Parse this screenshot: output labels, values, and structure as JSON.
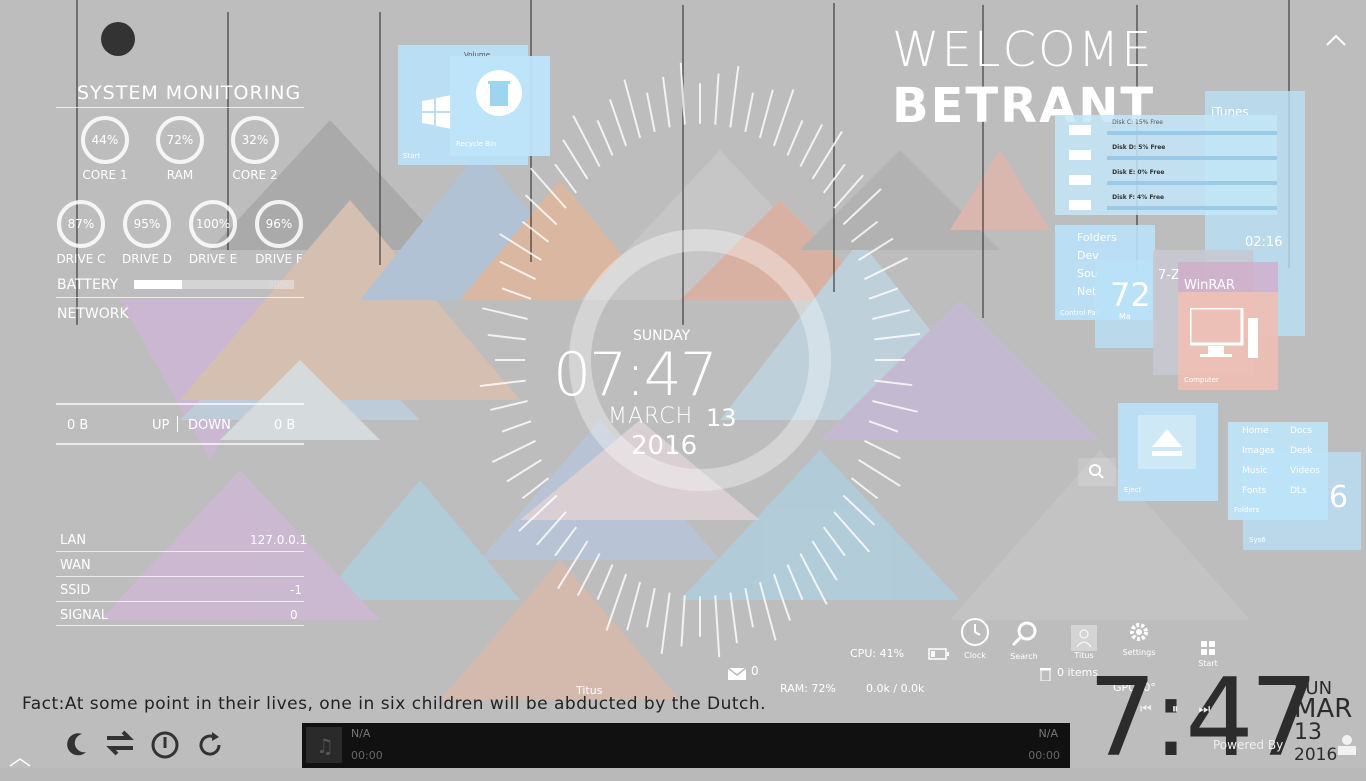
{
  "welcome": {
    "prefix": "WELCOME",
    "name": "BETRANT"
  },
  "monitor": {
    "title": "SYSTEM MONITORING",
    "cpu": [
      {
        "value": "44%",
        "label": "CORE 1"
      },
      {
        "value": "72%",
        "label": "RAM"
      },
      {
        "value": "32%",
        "label": "CORE 2"
      }
    ],
    "drives": [
      {
        "value": "87%",
        "label": "DRIVE C"
      },
      {
        "value": "95%",
        "label": "DRIVE D"
      },
      {
        "value": "100%",
        "label": "DRIVE E"
      },
      {
        "value": "96%",
        "label": "DRIVE F"
      }
    ],
    "battery_label": "BATTERY",
    "battery_value": "30%",
    "battery_level": 0.3,
    "network_label": "NETWORK",
    "net_left": "0 B",
    "net_up": "UP",
    "net_down": "DOWN",
    "net_right": "0 B",
    "rows": [
      {
        "label": "LAN",
        "value": "127.0.0.1"
      },
      {
        "label": "WAN",
        "value": ""
      },
      {
        "label": "SSID",
        "value": "-1"
      },
      {
        "label": "SIGNAL",
        "value": "0"
      }
    ]
  },
  "clock": {
    "day": "SUNDAY",
    "time": "07:47",
    "month": "MARCH",
    "date": "13",
    "year": "2016"
  },
  "tiles": {
    "volume": "Volume",
    "start": "Start",
    "recycle": "Recycle Bin",
    "disks": [
      "Disk C: 15% Free",
      "Disk D: 5% Free",
      "Disk E: 0% Free",
      "Disk F: 4% Free"
    ],
    "folders": "Folders",
    "devices": "Dev",
    "sounds": "Sou",
    "network": "Net",
    "control": "Control Pan",
    "sevenzip": "7-Z",
    "winrar": "WinRAR",
    "computer": "Computer",
    "eject": "Eject",
    "itunes": "iTunes",
    "time_small": "02:16",
    "mini_72": "72",
    "mini_ma": "Ma",
    "folders_list": [
      "Home",
      "Docs",
      "Images",
      "Desk",
      "Music",
      "Videos",
      "Fonts",
      "DLs"
    ],
    "folders_footer": "Folders",
    "sys_footer": "Sys6",
    "big_6": "6"
  },
  "taskbar": {
    "cpu": "CPU: 41%",
    "ram": "RAM: 72%",
    "net": "0.0k / 0.0k",
    "mail_count": "0",
    "recycle_items": "0 items",
    "gpu": "GPU: 0°",
    "titus_small": "Titus",
    "items": [
      {
        "label": "Clock"
      },
      {
        "label": "Search"
      },
      {
        "label": "Titus"
      },
      {
        "label": "Settings"
      },
      {
        "label": "Start"
      }
    ]
  },
  "fact": "Fact:At some point in their lives, one in six children will be abducted by the Dutch.",
  "player": {
    "track": "N/A",
    "time_left": "00:00",
    "track_right": "N/A",
    "time_right": "00:00"
  },
  "bigclock": {
    "time": "7:47",
    "day": "SUN",
    "month": "MAR",
    "date": "13",
    "year": "2016",
    "powered": "Powered By"
  },
  "icons": {
    "sleep": "moon-icon",
    "switch": "switch-user-icon",
    "power": "power-icon",
    "restart": "restart-icon"
  }
}
